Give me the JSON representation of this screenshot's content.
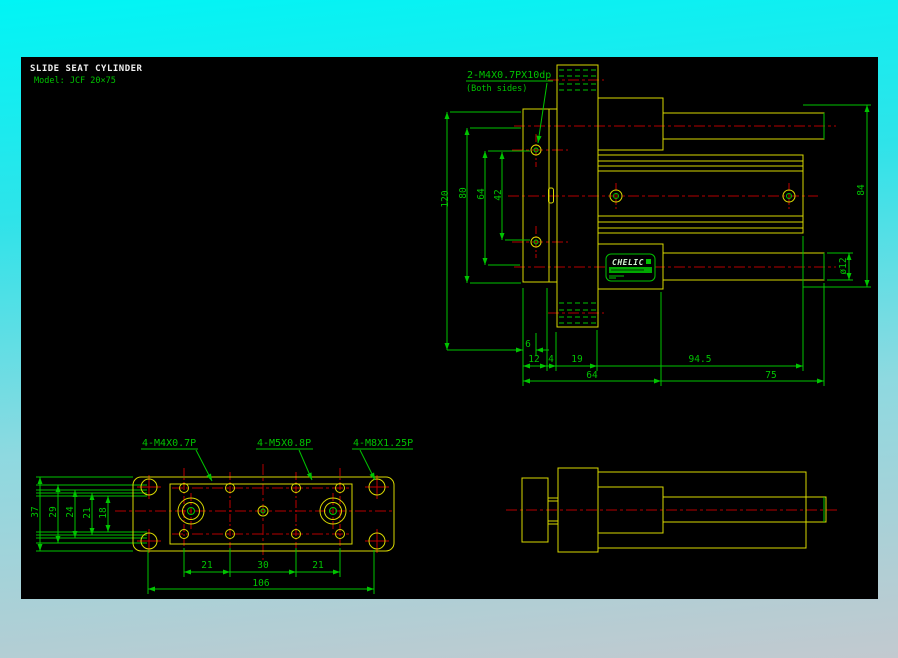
{
  "window": {
    "title": "SLIDE SEAT CYLINDER",
    "model": "Model:  JCF 20×75"
  },
  "colors": {
    "background_top": "#00f5f5",
    "background_bottom": "#c2c9cf",
    "canvas": "#000000",
    "part_outline": "#d9d900",
    "dimension": "#00c400",
    "centerline": "#b40000",
    "title_text": "#efefef"
  },
  "side_view": {
    "thread_label": "2-M4X0.7PX10dp",
    "thread_note": "(Both sides)",
    "brand": "CHELIC",
    "dims": {
      "d120": "120",
      "d80": "80",
      "d64v": "64",
      "d42": "42",
      "d84": "84",
      "dia12": "ø12",
      "d6": "6",
      "d12": "12",
      "d4": "4",
      "d19": "19",
      "d94_5": "94.5",
      "d64": "64",
      "d75": "75"
    }
  },
  "top_view": {
    "labels": {
      "m4": "4-M4X0.7P",
      "m5": "4-M5X0.8P",
      "m8": "4-M8X1.25P"
    },
    "dims": {
      "w37": "37",
      "w29": "29",
      "w24": "24",
      "w21": "21",
      "w18": "18",
      "p21a": "21",
      "p30": "30",
      "p21b": "21",
      "len106": "106"
    }
  }
}
